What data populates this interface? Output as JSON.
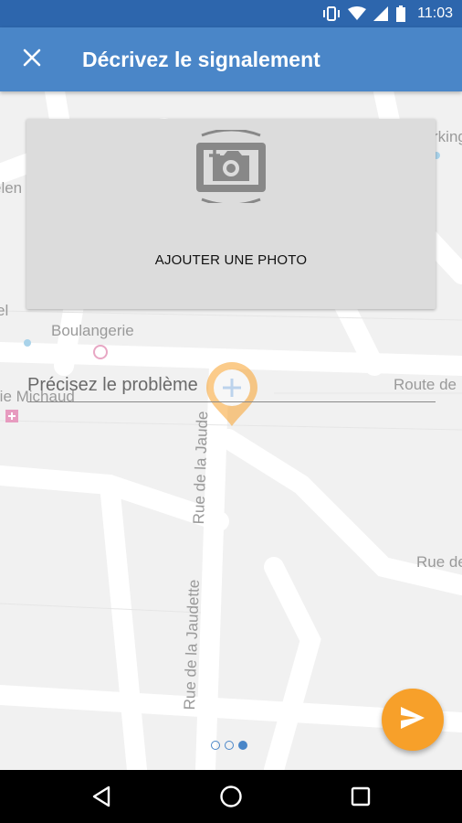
{
  "status_bar": {
    "time": "11:03",
    "icons": [
      "vibrate-icon",
      "wifi-icon",
      "signal-icon",
      "battery-icon"
    ]
  },
  "app_bar": {
    "title": "Décrivez le signalement",
    "close_icon": "close-icon",
    "background": "#4a86c8"
  },
  "photo": {
    "label": "AJOUTER UNE PHOTO",
    "icon": "add-photo-icon"
  },
  "input": {
    "placeholder": "Précisez le problème",
    "value": ""
  },
  "map": {
    "labels": {
      "boulangerie": "Boulangerie",
      "route": "Route de",
      "michaud": "rie Michaud",
      "rue_jaude": "Rue de la Jaude",
      "rue_jaudette": "Rue de la Jaudette",
      "rue_de": "Rue de",
      "parking": "rking",
      "ele": "elen",
      "el": "el"
    },
    "marker_color": "#f7a02a"
  },
  "pager": {
    "pages": 3,
    "active_index": 2
  },
  "fab": {
    "icon": "send-icon",
    "color": "#f7a02a"
  },
  "nav_bar": {
    "icons": [
      "back-icon",
      "home-icon",
      "recents-icon"
    ]
  }
}
